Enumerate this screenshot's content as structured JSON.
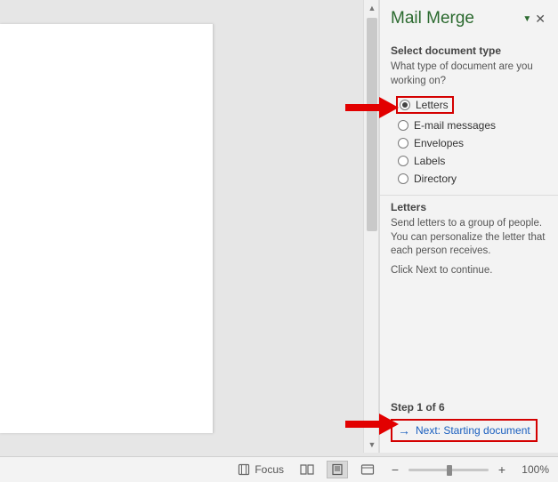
{
  "pane": {
    "title": "Mail Merge",
    "select_heading": "Select document type",
    "select_question": "What type of document are you working on?",
    "options": {
      "letters": "Letters",
      "email": "E-mail messages",
      "envelopes": "Envelopes",
      "labels": "Labels",
      "directory": "Directory"
    },
    "details_heading": "Letters",
    "details_text": "Send letters to a group of people. You can personalize the letter that each person receives.",
    "continue_text": "Click Next to continue.",
    "step_label": "Step 1 of 6",
    "next_link": "Next: Starting document"
  },
  "statusbar": {
    "focus": "Focus",
    "zoom_pct": "100%"
  }
}
